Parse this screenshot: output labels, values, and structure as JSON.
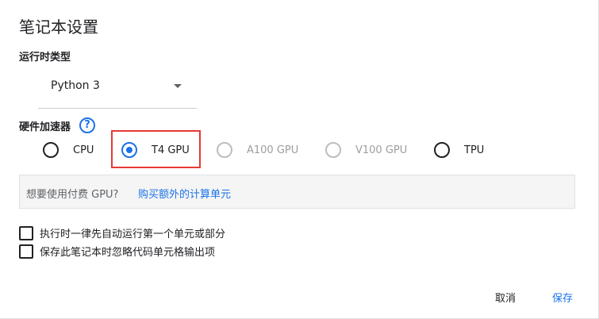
{
  "dialog": {
    "title": "笔记本设置",
    "runtime": {
      "label": "运行时类型",
      "selected": "Python 3"
    },
    "hardware": {
      "label": "硬件加速器",
      "help_icon": "?",
      "options": [
        {
          "label": "CPU",
          "state": "unchecked"
        },
        {
          "label": "T4 GPU",
          "state": "checked"
        },
        {
          "label": "A100 GPU",
          "state": "disabled"
        },
        {
          "label": "V100 GPU",
          "state": "disabled"
        },
        {
          "label": "TPU",
          "state": "unchecked"
        }
      ]
    },
    "notice": {
      "question": "想要使用付费 GPU?",
      "link": "购买额外的计算单元"
    },
    "checkboxes": [
      {
        "label": "执行时一律先自动运行第一个单元或部分",
        "checked": false
      },
      {
        "label": "保存此笔记本时忽略代码单元格输出项",
        "checked": false
      }
    ],
    "buttons": {
      "cancel": "取消",
      "save": "保存"
    }
  },
  "colors": {
    "accent": "#1a73e8",
    "highlight_box": "#e53935",
    "disabled": "#9e9e9e"
  }
}
